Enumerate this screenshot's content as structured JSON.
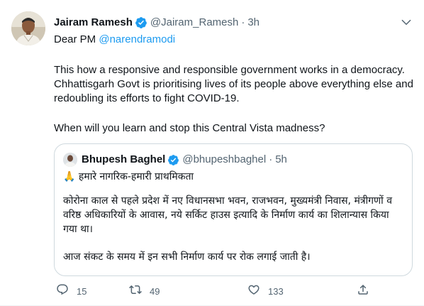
{
  "author": {
    "name": "Jairam Ramesh",
    "handle": "@Jairam_Ramesh",
    "time": "3h",
    "separator": "·"
  },
  "tweet": {
    "greeting": "Dear PM ",
    "mention": "@narendramodi",
    "paragraph1": "This how a responsive and responsible government works in a democracy. Chhattisgarh Govt is prioritising lives of its people above everything else and redoubling its efforts to fight COVID-19.",
    "paragraph2": "When will you learn and stop this Central Vista madness?"
  },
  "quote": {
    "name": "Bhupesh Baghel",
    "handle": "@bhupeshbaghel",
    "time": "5h",
    "separator": "·",
    "line1": "🙏 हमारे नागरिक-हमारी प्राथमिकता",
    "paragraph1": "कोरोना काल से पहले प्रदेश में नए विधानसभा भवन, राजभवन, मुख्यमंत्री निवास, मंत्रीगणों व वरिष्ठ अधिकारियों के आवास, नये सर्किट हाउस इत्यादि के निर्माण कार्य का शिलान्यास किया गया था।",
    "paragraph2": "आज संकट के समय में इन सभी निर्माण कार्य पर रोक लगाई जाती है।"
  },
  "actions": {
    "replies": "15",
    "retweets": "49",
    "likes": "133"
  },
  "icons": {
    "verified": "verified-badge-icon",
    "caret": "chevron-down-icon",
    "reply": "reply-icon",
    "retweet": "retweet-icon",
    "like": "heart-icon",
    "share": "share-icon"
  },
  "colors": {
    "accent": "#1d9bf0",
    "text": "#0f1419",
    "muted": "#536471",
    "border": "#cfd9de"
  }
}
